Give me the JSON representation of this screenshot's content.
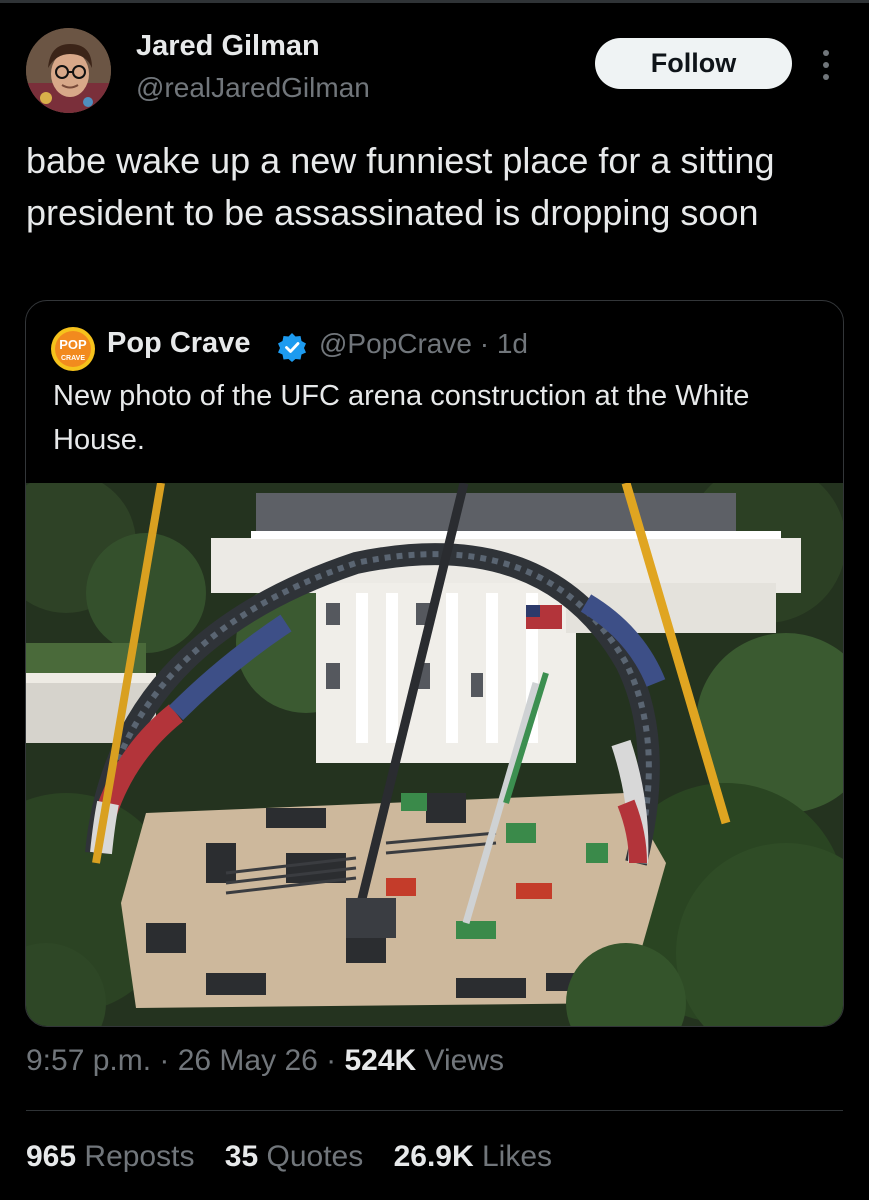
{
  "tweet": {
    "author_name": "Jared Gilman",
    "author_handle": "@realJaredGilman",
    "follow_label": "Follow",
    "text": "babe wake up a new funniest place for a sitting president to be assassinated is dropping soon"
  },
  "quote": {
    "logo_text_top": "POP",
    "logo_text_bottom": "CRAVE",
    "author_name": "Pop Crave",
    "handle_time": "@PopCrave · 1d",
    "text": "New photo of the UFC arena construction at the White House.",
    "photo_icon": "photo-image"
  },
  "meta": {
    "timestamp": "9:57 p.m. · 26 May 26 · ",
    "views_count": "524K",
    "views_label": " Views"
  },
  "stats": {
    "reposts_count": "965",
    "reposts_label": " Reposts",
    "quotes_count": "35",
    "quotes_label": " Quotes",
    "likes_count": "26.9K",
    "likes_label": " Likes"
  },
  "colors": {
    "background": "#000000",
    "text_primary": "#e7e9ea",
    "text_secondary": "#71767b",
    "verified_blue": "#1d9bf0",
    "follow_bg": "#eff3f4"
  },
  "icons": [
    "avatar",
    "more-icon",
    "pop-crave-logo",
    "verified-badge-icon"
  ]
}
